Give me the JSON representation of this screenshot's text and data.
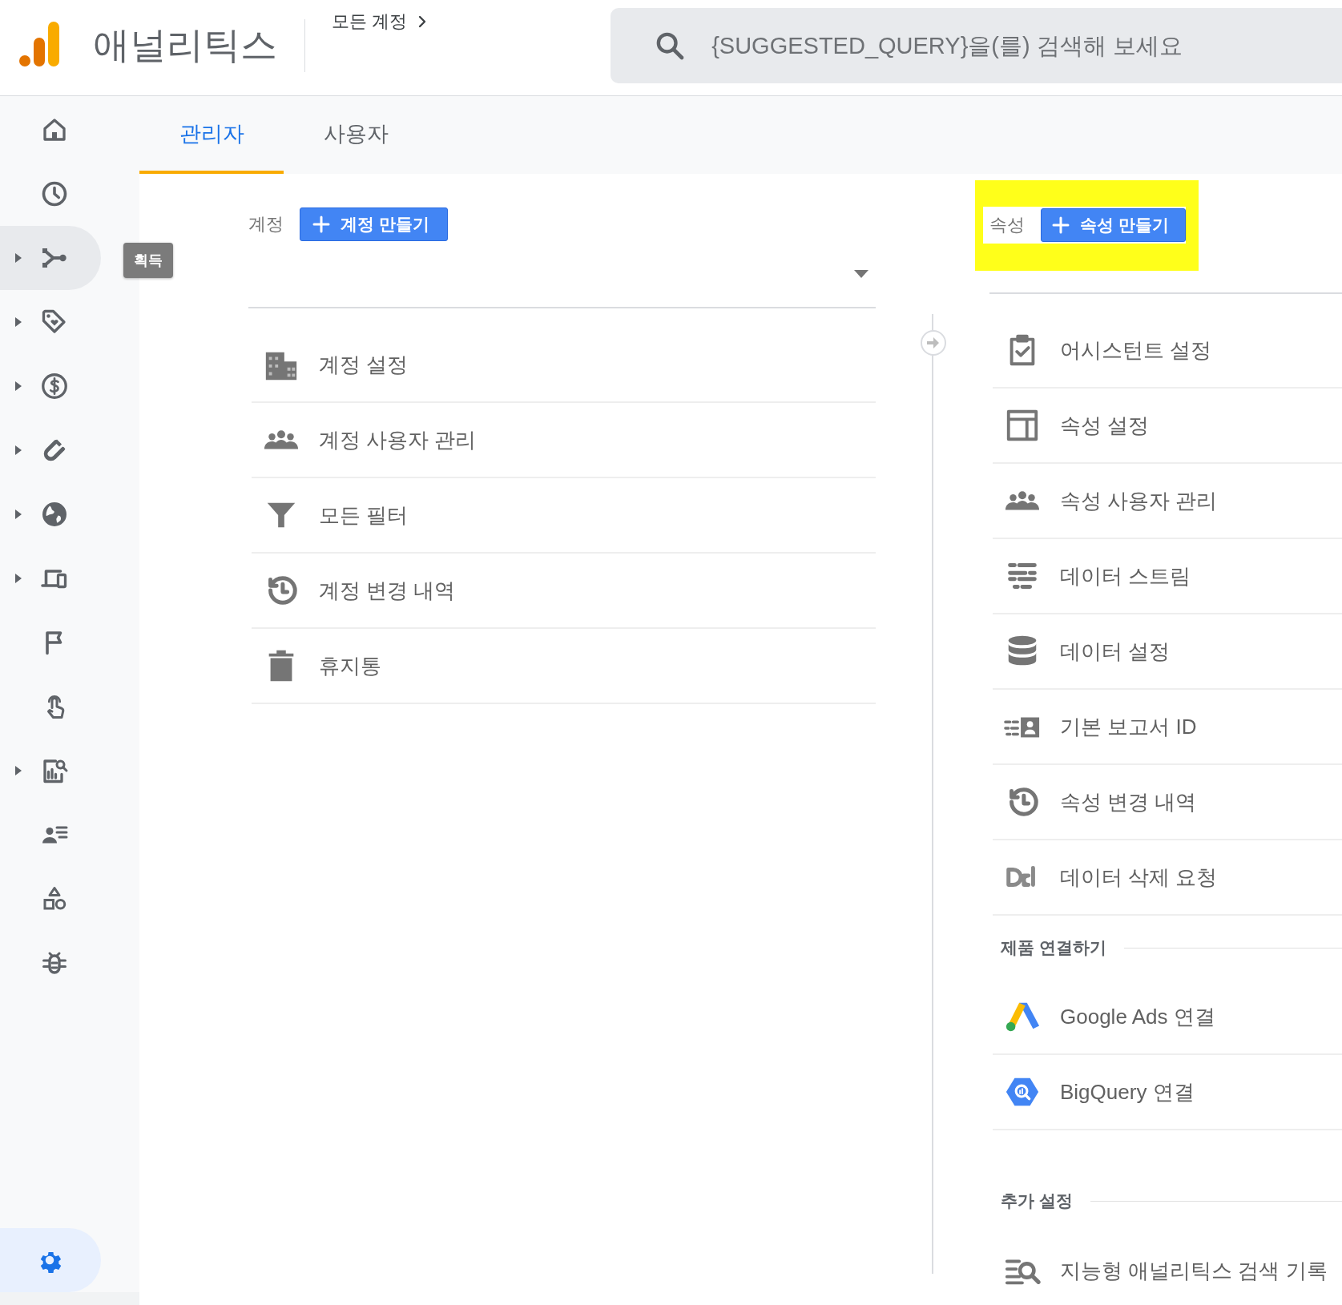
{
  "header": {
    "app_title": "애널리틱스",
    "breadcrumb": "모든 계정",
    "search": {
      "placeholder": "{SUGGESTED_QUERY}을(를) 검색해 보세요"
    }
  },
  "sidebar": {
    "items": [
      {
        "expandable": false,
        "selected": false
      },
      {
        "expandable": false,
        "selected": false
      },
      {
        "expandable": true,
        "selected": true
      },
      {
        "expandable": true,
        "selected": false
      },
      {
        "expandable": true,
        "selected": false
      },
      {
        "expandable": true,
        "selected": false
      },
      {
        "expandable": true,
        "selected": false
      },
      {
        "expandable": true,
        "selected": false
      },
      {
        "expandable": false,
        "selected": false
      },
      {
        "expandable": false,
        "selected": false
      },
      {
        "expandable": true,
        "selected": false
      },
      {
        "expandable": false,
        "selected": false
      },
      {
        "expandable": false,
        "selected": false
      },
      {
        "expandable": false,
        "selected": false
      }
    ],
    "tooltip": "획득",
    "settings": {
      "selected": true
    }
  },
  "tabs": [
    {
      "label": "관리자",
      "selected": true
    },
    {
      "label": "사용자",
      "selected": false
    }
  ],
  "account_column": {
    "label": "계정",
    "create_button": "계정 만들기",
    "items": [
      {
        "label": "계정 설정"
      },
      {
        "label": "계정 사용자 관리"
      },
      {
        "label": "모든 필터"
      },
      {
        "label": "계정 변경 내역"
      },
      {
        "label": "휴지통"
      }
    ]
  },
  "property_column": {
    "label": "속성",
    "create_button": "속성 만들기",
    "highlighted": true,
    "items": [
      {
        "label": "어시스턴트 설정"
      },
      {
        "label": "속성 설정"
      },
      {
        "label": "속성 사용자 관리"
      },
      {
        "label": "데이터 스트림"
      },
      {
        "label": "데이터 설정"
      },
      {
        "label": "기본 보고서 ID"
      },
      {
        "label": "속성 변경 내역"
      },
      {
        "label": "데이터 삭제 요청"
      }
    ],
    "sections": [
      {
        "title": "제품 연결하기",
        "items": [
          {
            "label": "Google Ads 연결"
          },
          {
            "label": "BigQuery 연결"
          }
        ]
      },
      {
        "title": "추가 설정",
        "items": [
          {
            "label": "지능형 애널리틱스 검색 기록"
          }
        ]
      }
    ]
  }
}
